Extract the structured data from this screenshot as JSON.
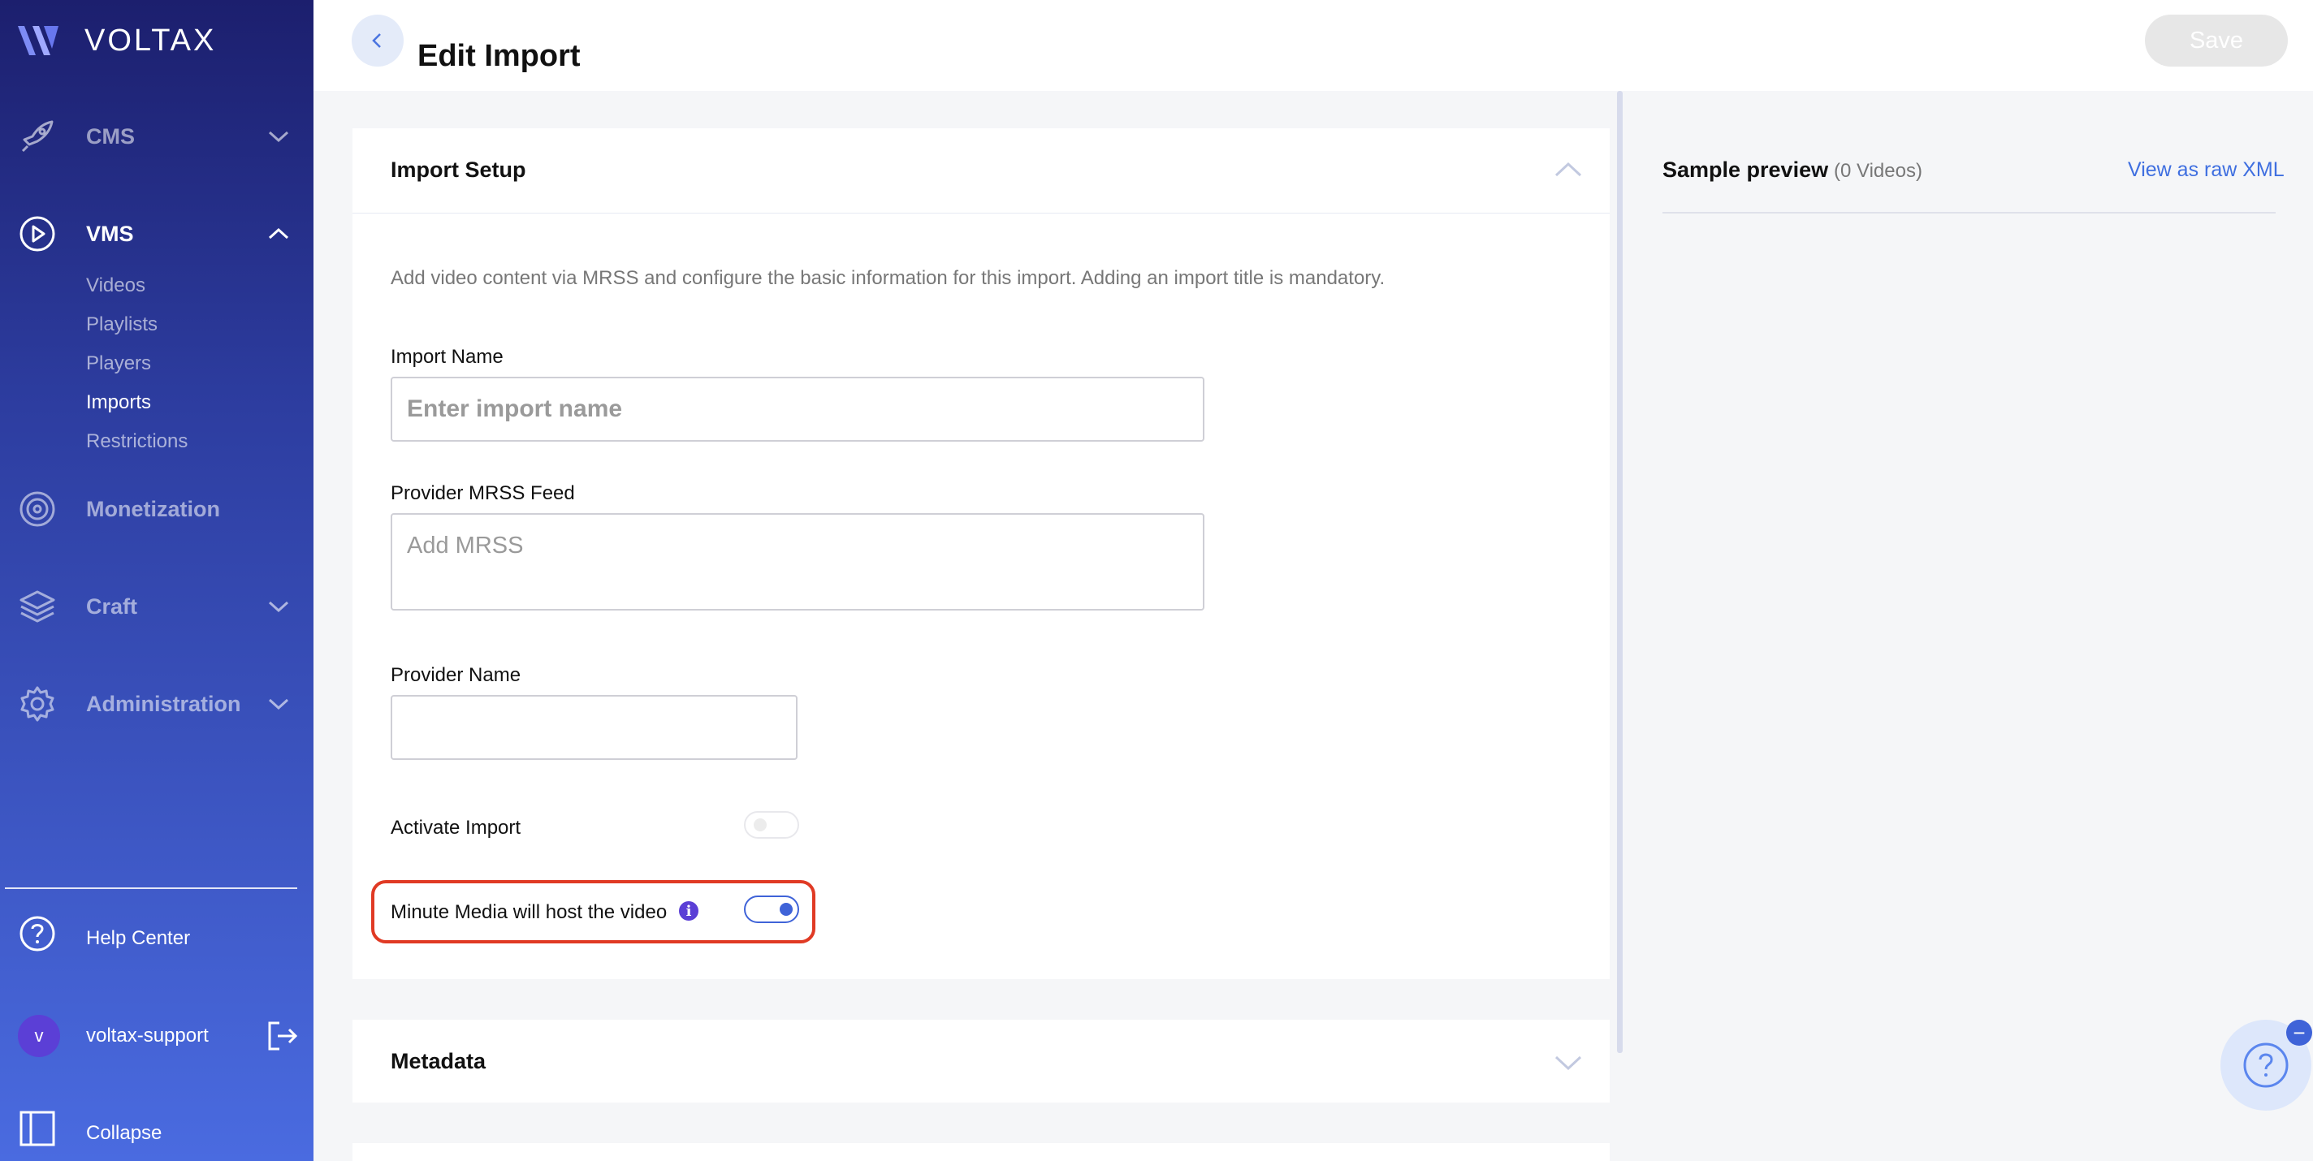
{
  "brand": {
    "name": "VOLTAX"
  },
  "sidebar": {
    "items": [
      {
        "label": "CMS",
        "icon": "rocket-icon"
      },
      {
        "label": "VMS",
        "icon": "play-circle-icon"
      },
      {
        "label": "Monetization",
        "icon": "target-icon"
      },
      {
        "label": "Craft",
        "icon": "layers-icon"
      },
      {
        "label": "Administration",
        "icon": "gear-icon"
      }
    ],
    "vms_sub": [
      "Videos",
      "Playlists",
      "Players",
      "Imports",
      "Restrictions"
    ],
    "help": "Help Center",
    "user": {
      "initial": "v",
      "name": "voltax-support"
    },
    "collapse": "Collapse"
  },
  "header": {
    "title": "Edit Import",
    "save_label": "Save"
  },
  "import_setup": {
    "title": "Import Setup",
    "description": "Add video content via MRSS and configure the basic information for this import. Adding an import title is mandatory.",
    "import_name_label": "Import Name",
    "import_name_placeholder": "Enter import name",
    "mrss_label": "Provider MRSS Feed",
    "mrss_placeholder": "Add MRSS",
    "provider_name_label": "Provider Name",
    "provider_name_value": "",
    "activate_label": "Activate Import",
    "activate_on": false,
    "host_label": "Minute Media will host the video",
    "host_on": true
  },
  "metadata": {
    "title": "Metadata"
  },
  "preview": {
    "title": "Sample preview",
    "count": "(0 Videos)",
    "raw_link": "View as raw XML"
  },
  "colors": {
    "accent": "#3f63d8",
    "highlight": "#e03a24",
    "sidebar_top": "#1c1f6e",
    "sidebar_bottom": "#4a6be0"
  }
}
